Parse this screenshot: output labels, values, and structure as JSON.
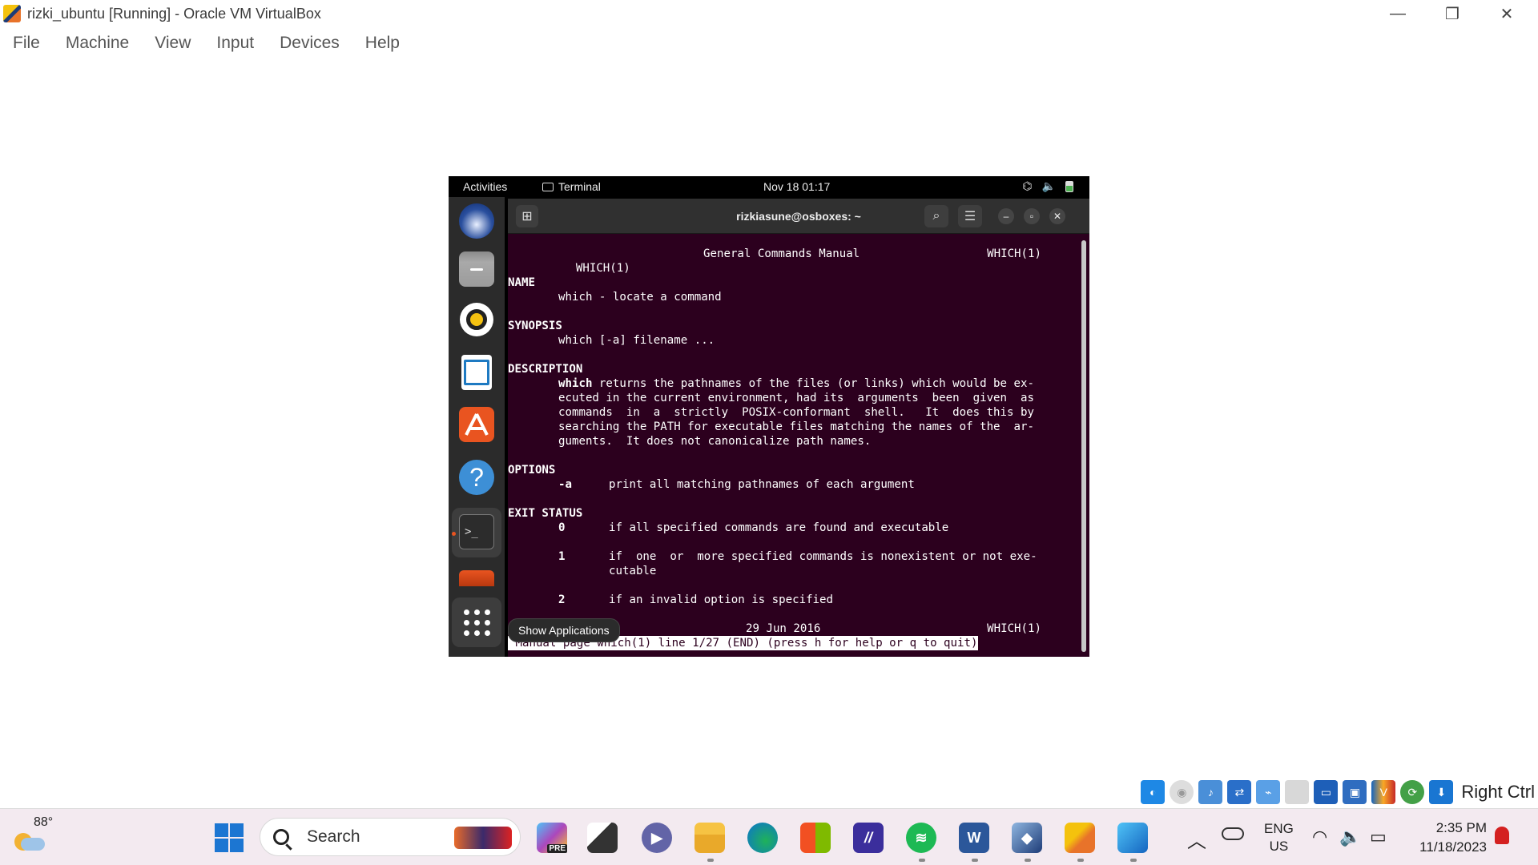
{
  "window": {
    "title": "rizki_ubuntu [Running] - Oracle VM VirtualBox",
    "controls": [
      "minimize-icon",
      "restore-icon",
      "close-icon"
    ]
  },
  "menu": [
    "File",
    "Machine",
    "View",
    "Input",
    "Devices",
    "Help"
  ],
  "ubuntu": {
    "activities": "Activities",
    "app_label": "Terminal",
    "clock": "Nov 18  01:17",
    "dock_apps": [
      "thunderbird-icon",
      "files-icon",
      "rhythmbox-icon",
      "writer-icon",
      "app-center-icon",
      "help-icon",
      "terminal-icon",
      "show-applications-icon"
    ],
    "help_glyph": "?",
    "terminal_glyph": ">_",
    "tooltip": "Show Applications"
  },
  "terminal": {
    "title": "rizkiasune@osboxes: ~",
    "header_left": "WHICH(1)",
    "header_center": "General Commands Manual",
    "header_right": "WHICH(1)",
    "name_heading": "NAME",
    "name_text": "which - locate a command",
    "synopsis_heading": "SYNOPSIS",
    "synopsis_text": "which [-a] filename ...",
    "description_heading": "DESCRIPTION",
    "desc_bold": "which",
    "desc_l1_rest": " returns the pathnames of the files (or links) which would be ex-",
    "desc_l2": "ecuted in the current environment, had its  arguments  been  given  as",
    "desc_l3": "commands  in  a  strictly  POSIX-conformant  shell.   It  does this by",
    "desc_l4": "searching the PATH for executable files matching the names of the  ar-",
    "desc_l5": "guments.  It does not canonicalize path names.",
    "options_heading": "OPTIONS",
    "opt_flag": "-a",
    "opt_text": "print all matching pathnames of each argument",
    "exit_heading": "EXIT STATUS",
    "exit_0": "0",
    "exit_0_text": "if all specified commands are found and executable",
    "exit_1": "1",
    "exit_1_text": "if  one  or  more specified commands is nonexistent or not exe-",
    "exit_1_text2": "cutable",
    "exit_2": "2",
    "exit_2_text": "if an invalid option is specified",
    "footer_date": "29 Jun 2016",
    "footer_right": "WHICH(1)",
    "status": " Manual page which(1) line 1/27 (END) (press h for help or q to quit)"
  },
  "vbox_status": {
    "icons": [
      "hard-disk-icon",
      "optical-drive-icon",
      "audio-icon",
      "network-icon",
      "usb-icon",
      "shared-folders-icon",
      "display-icon",
      "recording-icon",
      "vt-x-icon",
      "guest-additions-icon",
      "download-icon"
    ],
    "vt_glyph": "V",
    "host_key": "Right Ctrl"
  },
  "taskbar": {
    "temperature": "88°",
    "search_placeholder": "Search",
    "pinned_apps": [
      "copilot-icon",
      "task-view-icon",
      "teams-icon",
      "file-explorer-icon",
      "edge-icon",
      "microsoft-store-icon",
      "ai-app-icon",
      "spotify-icon",
      "word-icon",
      "virtualbox-icon",
      "sublime-icon",
      "photos-icon"
    ],
    "copilot_badge": "PRE",
    "word_glyph": "W",
    "ai_glyph": "//",
    "language": "ENG",
    "region": "US",
    "time": "2:35 PM",
    "date": "11/18/2023"
  }
}
